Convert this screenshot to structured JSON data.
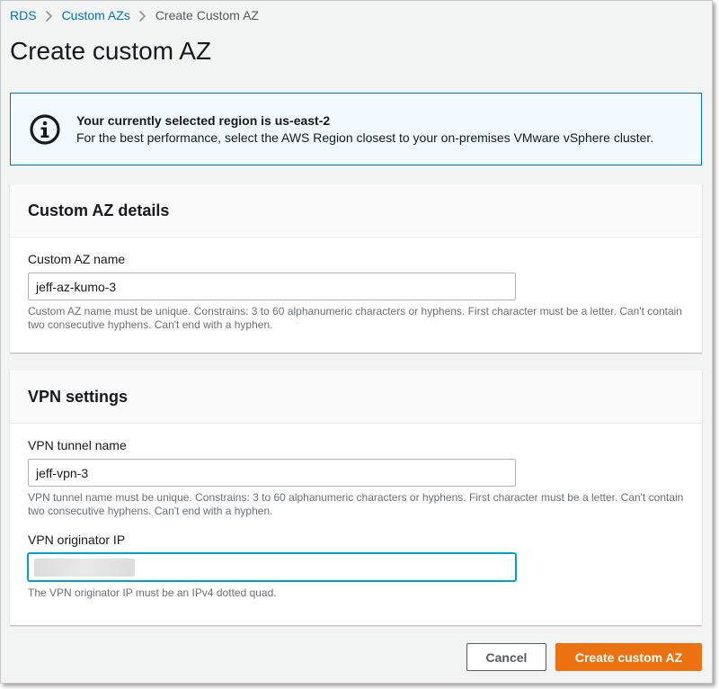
{
  "breadcrumb": {
    "items": [
      "RDS",
      "Custom AZs"
    ],
    "current": "Create Custom AZ"
  },
  "page": {
    "title": "Create custom AZ"
  },
  "alert": {
    "icon": "info-icon",
    "title": "Your currently selected region is us-east-2",
    "message": "For the best performance, select the AWS Region closest to your on-premises VMware vSphere cluster."
  },
  "custom_az": {
    "header": "Custom AZ details",
    "name_label": "Custom AZ name",
    "name_value": "jeff-az-kumo-3",
    "name_hint": "Custom AZ name must be unique. Constrains: 3 to 60 alphanumeric characters or hyphens. First character must be a letter. Can't contain two consecutive hyphens. Can't end with a hyphen."
  },
  "vpn": {
    "header": "VPN settings",
    "tunnel_label": "VPN tunnel name",
    "tunnel_value": "jeff-vpn-3",
    "tunnel_hint": "VPN tunnel name must be unique. Constrains: 3 to 60 alphanumeric characters or hyphens. First character must be a letter. Can't contain two consecutive hyphens. Can't end with a hyphen.",
    "ip_label": "VPN originator IP",
    "ip_hint": "The VPN originator IP must be an IPv4 dotted quad."
  },
  "actions": {
    "cancel_label": "Cancel",
    "create_label": "Create custom AZ"
  },
  "colors": {
    "link": "#0073bb",
    "primary": "#ec7211",
    "info_border": "#0073bb",
    "info_bg": "#f1faff",
    "focus": "#00a1c9"
  }
}
